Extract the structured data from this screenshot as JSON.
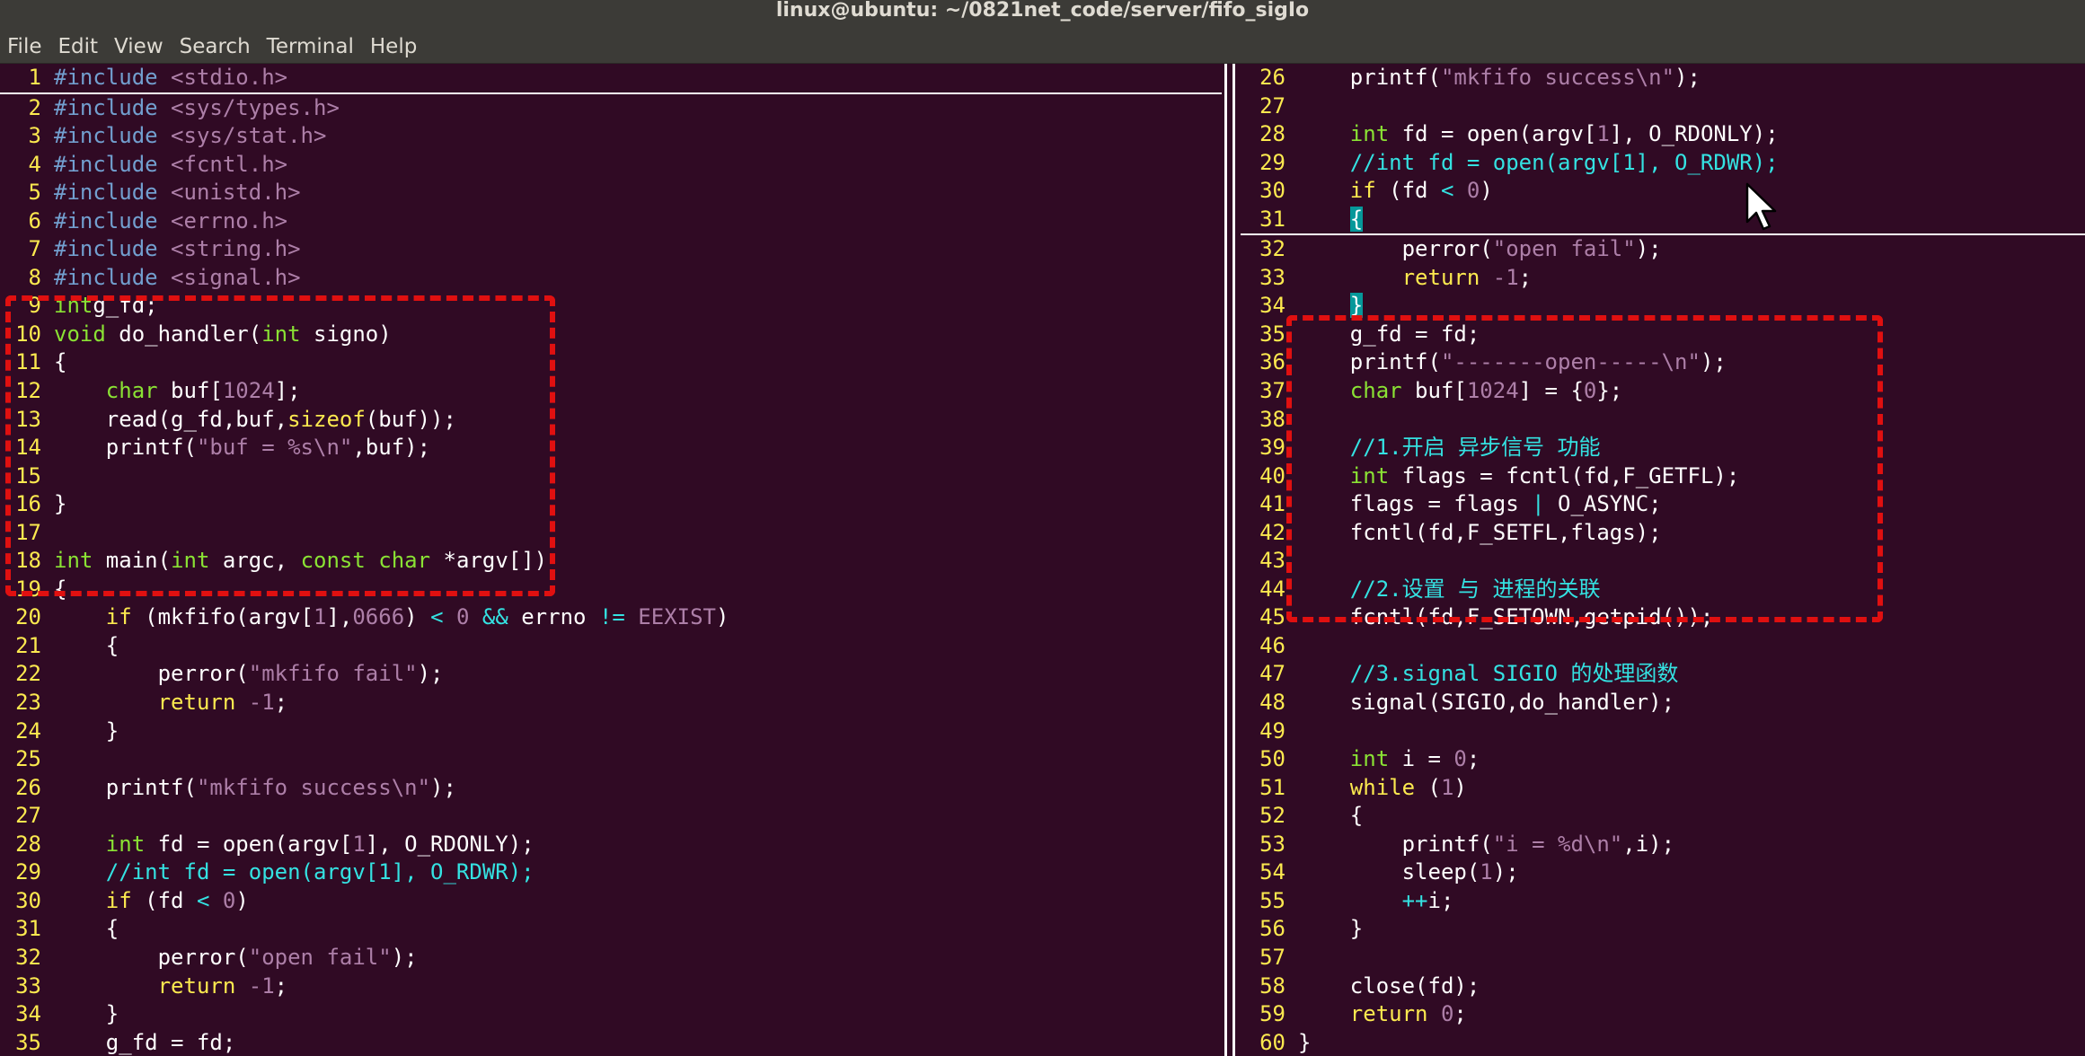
{
  "window": {
    "title": "linux@ubuntu: ~/0821net_code/server/fifo_sigIo"
  },
  "menu": [
    "File",
    "Edit",
    "View",
    "Search",
    "Terminal",
    "Help"
  ],
  "left_pane": {
    "lines": [
      {
        "n": "1",
        "t": [
          [
            "pp",
            "#include "
          ],
          [
            "hdr",
            "<stdio.h>"
          ]
        ]
      },
      {
        "n": "2",
        "t": [
          [
            "pp",
            "#include "
          ],
          [
            "hdr",
            "<sys/types.h>"
          ]
        ]
      },
      {
        "n": "3",
        "t": [
          [
            "pp",
            "#include "
          ],
          [
            "hdr",
            "<sys/stat.h>"
          ]
        ]
      },
      {
        "n": "4",
        "t": [
          [
            "pp",
            "#include "
          ],
          [
            "hdr",
            "<fcntl.h>"
          ]
        ]
      },
      {
        "n": "5",
        "t": [
          [
            "pp",
            "#include "
          ],
          [
            "hdr",
            "<unistd.h>"
          ]
        ]
      },
      {
        "n": "6",
        "t": [
          [
            "pp",
            "#include "
          ],
          [
            "hdr",
            "<errno.h>"
          ]
        ]
      },
      {
        "n": "7",
        "t": [
          [
            "pp",
            "#include "
          ],
          [
            "hdr",
            "<string.h>"
          ]
        ]
      },
      {
        "n": "8",
        "t": [
          [
            "pp",
            "#include "
          ],
          [
            "hdr",
            "<signal.h>"
          ]
        ]
      },
      {
        "n": "9",
        "t": [
          [
            "ty",
            "int"
          ],
          [
            "",
            "g_fd;"
          ]
        ]
      },
      {
        "n": "10",
        "t": [
          [
            "ty",
            "void"
          ],
          [
            "",
            " do_handler("
          ],
          [
            "ty",
            "int"
          ],
          [
            "",
            " signo)"
          ]
        ]
      },
      {
        "n": "11",
        "t": [
          [
            "",
            "{"
          ]
        ]
      },
      {
        "n": "12",
        "t": [
          [
            "",
            "    "
          ],
          [
            "ty",
            "char"
          ],
          [
            "",
            " buf["
          ],
          [
            "num",
            "1024"
          ],
          [
            "",
            "];"
          ]
        ]
      },
      {
        "n": "13",
        "t": [
          [
            "",
            "    read(g_fd,buf,"
          ],
          [
            "kw",
            "sizeof"
          ],
          [
            "",
            "(buf));"
          ]
        ]
      },
      {
        "n": "14",
        "t": [
          [
            "",
            "    printf("
          ],
          [
            "str",
            "\"buf = %s\\n\""
          ],
          [
            "",
            ",buf);"
          ]
        ]
      },
      {
        "n": "15",
        "t": []
      },
      {
        "n": "16",
        "t": [
          [
            "",
            "}"
          ]
        ]
      },
      {
        "n": "17",
        "t": []
      },
      {
        "n": "18",
        "t": [
          [
            "ty",
            "int"
          ],
          [
            "",
            " main("
          ],
          [
            "ty",
            "int"
          ],
          [
            "",
            " argc, "
          ],
          [
            "ty",
            "const char"
          ],
          [
            "",
            " *argv[])"
          ]
        ]
      },
      {
        "n": "19",
        "t": [
          [
            "",
            "{"
          ]
        ]
      },
      {
        "n": "20",
        "t": [
          [
            "",
            "    "
          ],
          [
            "kw",
            "if"
          ],
          [
            "",
            " (mkfifo(argv["
          ],
          [
            "num",
            "1"
          ],
          [
            "",
            "],"
          ],
          [
            "num",
            "0666"
          ],
          [
            "",
            ") "
          ],
          [
            "op",
            "<"
          ],
          [
            "",
            " "
          ],
          [
            "num",
            "0"
          ],
          [
            "",
            " "
          ],
          [
            "op",
            "&&"
          ],
          [
            "",
            " errno "
          ],
          [
            "op",
            "!="
          ],
          [
            "",
            " "
          ],
          [
            "hdr",
            "EEXIST"
          ],
          [
            "",
            ")"
          ]
        ]
      },
      {
        "n": "21",
        "t": [
          [
            "",
            "    {"
          ]
        ]
      },
      {
        "n": "22",
        "t": [
          [
            "",
            "        perror("
          ],
          [
            "str",
            "\"mkfifo fail\""
          ],
          [
            "",
            ");"
          ]
        ]
      },
      {
        "n": "23",
        "t": [
          [
            "",
            "        "
          ],
          [
            "kw",
            "return"
          ],
          [
            "",
            " "
          ],
          [
            "num",
            "-1"
          ],
          [
            "",
            ";"
          ]
        ]
      },
      {
        "n": "24",
        "t": [
          [
            "",
            "    }"
          ]
        ]
      },
      {
        "n": "25",
        "t": []
      },
      {
        "n": "26",
        "t": [
          [
            "",
            "    printf("
          ],
          [
            "str",
            "\"mkfifo success\\n\""
          ],
          [
            "",
            ");"
          ]
        ]
      },
      {
        "n": "27",
        "t": []
      },
      {
        "n": "28",
        "t": [
          [
            "",
            "    "
          ],
          [
            "ty",
            "int"
          ],
          [
            "",
            " fd = open(argv["
          ],
          [
            "num",
            "1"
          ],
          [
            "",
            "], O_RDONLY);"
          ]
        ]
      },
      {
        "n": "29",
        "t": [
          [
            "",
            "    "
          ],
          [
            "cmt",
            "//int fd = open(argv[1], O_RDWR);"
          ]
        ]
      },
      {
        "n": "30",
        "t": [
          [
            "",
            "    "
          ],
          [
            "kw",
            "if"
          ],
          [
            "",
            " (fd "
          ],
          [
            "op",
            "<"
          ],
          [
            "",
            " "
          ],
          [
            "num",
            "0"
          ],
          [
            "",
            ")"
          ]
        ]
      },
      {
        "n": "31",
        "t": [
          [
            "",
            "    {"
          ]
        ]
      },
      {
        "n": "32",
        "t": [
          [
            "",
            "        perror("
          ],
          [
            "str",
            "\"open fail\""
          ],
          [
            "",
            ");"
          ]
        ]
      },
      {
        "n": "33",
        "t": [
          [
            "",
            "        "
          ],
          [
            "kw",
            "return"
          ],
          [
            "",
            " "
          ],
          [
            "num",
            "-1"
          ],
          [
            "",
            ";"
          ]
        ]
      },
      {
        "n": "34",
        "t": [
          [
            "",
            "    }"
          ]
        ]
      },
      {
        "n": "35",
        "t": [
          [
            "",
            "    g_fd = fd;"
          ]
        ]
      }
    ]
  },
  "right_pane": {
    "lines": [
      {
        "n": "26",
        "t": [
          [
            "",
            "    printf("
          ],
          [
            "str",
            "\"mkfifo success\\n\""
          ],
          [
            "",
            ");"
          ]
        ]
      },
      {
        "n": "27",
        "t": []
      },
      {
        "n": "28",
        "t": [
          [
            "",
            "    "
          ],
          [
            "ty",
            "int"
          ],
          [
            "",
            " fd = open(argv["
          ],
          [
            "num",
            "1"
          ],
          [
            "",
            "], O_RDONLY);"
          ]
        ]
      },
      {
        "n": "29",
        "t": [
          [
            "",
            "    "
          ],
          [
            "cmt",
            "//int fd = open(argv[1], O_RDWR);"
          ]
        ]
      },
      {
        "n": "30",
        "t": [
          [
            "",
            "    "
          ],
          [
            "kw",
            "if"
          ],
          [
            "",
            " (fd "
          ],
          [
            "op",
            "<"
          ],
          [
            "",
            " "
          ],
          [
            "num",
            "0"
          ],
          [
            "",
            ")"
          ]
        ]
      },
      {
        "n": "31",
        "t": [
          [
            "",
            "    "
          ],
          [
            "bracehl",
            "{"
          ]
        ]
      },
      {
        "n": "32",
        "t": [
          [
            "",
            "        perror("
          ],
          [
            "str",
            "\"open fail\""
          ],
          [
            "",
            ");"
          ]
        ]
      },
      {
        "n": "33",
        "t": [
          [
            "",
            "        "
          ],
          [
            "kw",
            "return"
          ],
          [
            "",
            " "
          ],
          [
            "num",
            "-1"
          ],
          [
            "",
            ";"
          ]
        ]
      },
      {
        "n": "34",
        "t": [
          [
            "",
            "    "
          ],
          [
            "bracehl",
            "}"
          ]
        ]
      },
      {
        "n": "35",
        "t": [
          [
            "",
            "    g_fd = fd;"
          ]
        ]
      },
      {
        "n": "36",
        "t": [
          [
            "",
            "    printf("
          ],
          [
            "str",
            "\"-------open-----\\n\""
          ],
          [
            "",
            ");"
          ]
        ]
      },
      {
        "n": "37",
        "t": [
          [
            "",
            "    "
          ],
          [
            "ty",
            "char"
          ],
          [
            "",
            " buf["
          ],
          [
            "num",
            "1024"
          ],
          [
            "",
            "] = {"
          ],
          [
            "num",
            "0"
          ],
          [
            "",
            "};"
          ]
        ]
      },
      {
        "n": "38",
        "t": []
      },
      {
        "n": "39",
        "t": [
          [
            "",
            "    "
          ],
          [
            "cmt",
            "//1.开启 异步信号 功能"
          ]
        ]
      },
      {
        "n": "40",
        "t": [
          [
            "",
            "    "
          ],
          [
            "ty",
            "int"
          ],
          [
            "",
            " flags = fcntl(fd,F_GETFL);"
          ]
        ]
      },
      {
        "n": "41",
        "t": [
          [
            "",
            "    flags = flags "
          ],
          [
            "op",
            "|"
          ],
          [
            "",
            " O_ASYNC;"
          ]
        ]
      },
      {
        "n": "42",
        "t": [
          [
            "",
            "    fcntl(fd,F_SETFL,flags);"
          ]
        ]
      },
      {
        "n": "43",
        "t": []
      },
      {
        "n": "44",
        "t": [
          [
            "",
            "    "
          ],
          [
            "cmt",
            "//2.设置 与 进程的关联"
          ]
        ]
      },
      {
        "n": "45",
        "t": [
          [
            "",
            "    fcntl(fd,F_SETOWN,getpid());"
          ]
        ]
      },
      {
        "n": "46",
        "t": []
      },
      {
        "n": "47",
        "t": [
          [
            "",
            "    "
          ],
          [
            "cmt",
            "//3.signal SIGIO 的处理函数"
          ]
        ]
      },
      {
        "n": "48",
        "t": [
          [
            "",
            "    signal(SIGIO,do_handler);"
          ]
        ]
      },
      {
        "n": "49",
        "t": []
      },
      {
        "n": "50",
        "t": [
          [
            "",
            "    "
          ],
          [
            "ty",
            "int"
          ],
          [
            "",
            " i = "
          ],
          [
            "num",
            "0"
          ],
          [
            "",
            ";"
          ]
        ]
      },
      {
        "n": "51",
        "t": [
          [
            "",
            "    "
          ],
          [
            "kw",
            "while"
          ],
          [
            "",
            " ("
          ],
          [
            "num",
            "1"
          ],
          [
            "",
            ")"
          ]
        ]
      },
      {
        "n": "52",
        "t": [
          [
            "",
            "    {"
          ]
        ]
      },
      {
        "n": "53",
        "t": [
          [
            "",
            "        printf("
          ],
          [
            "str",
            "\"i = %d\\n\""
          ],
          [
            "",
            ",i);"
          ]
        ]
      },
      {
        "n": "54",
        "t": [
          [
            "",
            "        sleep("
          ],
          [
            "num",
            "1"
          ],
          [
            "",
            ");"
          ]
        ]
      },
      {
        "n": "55",
        "t": [
          [
            "",
            "        "
          ],
          [
            "op",
            "++"
          ],
          [
            "",
            "i;"
          ]
        ]
      },
      {
        "n": "56",
        "t": [
          [
            "",
            "    }"
          ]
        ]
      },
      {
        "n": "57",
        "t": []
      },
      {
        "n": "58",
        "t": [
          [
            "",
            "    close(fd);"
          ]
        ]
      },
      {
        "n": "59",
        "t": [
          [
            "",
            "    "
          ],
          [
            "kw",
            "return"
          ],
          [
            "",
            " "
          ],
          [
            "num",
            "0"
          ],
          [
            "",
            ";"
          ]
        ]
      },
      {
        "n": "60",
        "t": [
          [
            "",
            "}"
          ]
        ]
      }
    ]
  },
  "colors": {
    "background": "#300a24",
    "line_number": "#fce94f",
    "annotation_box": "#e01010"
  }
}
